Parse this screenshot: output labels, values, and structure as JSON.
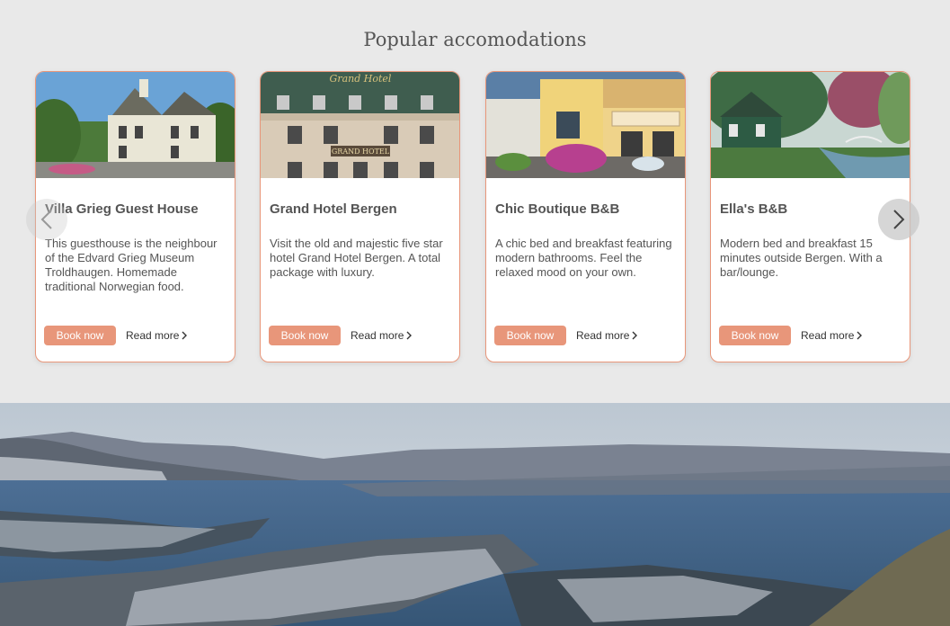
{
  "section": {
    "title": "Popular accomodations"
  },
  "cards": [
    {
      "title": "Villa Grieg Guest House",
      "description": "This guesthouse is the neighbour of the Edvard Grieg Museum Troldhaugen. Homemade traditional Norwegian food.",
      "book_label": "Book now",
      "read_more_label": "Read more",
      "image_icon": "villa-photo"
    },
    {
      "title": "Grand Hotel Bergen",
      "description": "Visit the old and majestic five star hotel Grand Hotel Bergen. A total package with luxury.",
      "book_label": "Book now",
      "read_more_label": "Read more",
      "image_icon": "hotel-facade-photo",
      "image_sign": "GRAND HOTEL",
      "image_roof_text": "Grand Hotel"
    },
    {
      "title": "Chic Boutique B&B",
      "description": "A chic bed and breakfast featuring modern bathrooms. Feel the relaxed mood on your own.",
      "book_label": "Book now",
      "read_more_label": "Read more",
      "image_icon": "boutique-street-photo"
    },
    {
      "title": "Ella's B&B",
      "description": "Modern bed and breakfast 15 minutes outside Bergen. With a bar/lounge.",
      "book_label": "Book now",
      "read_more_label": "Read more",
      "image_icon": "garden-house-photo"
    }
  ],
  "carousel": {
    "prev_icon": "chevron-left-icon",
    "next_icon": "chevron-right-icon"
  },
  "hero": {
    "image_icon": "bergen-fjord-photo"
  },
  "colors": {
    "accent": "#e8967a",
    "background": "#e9e9e9",
    "text": "#555555"
  }
}
